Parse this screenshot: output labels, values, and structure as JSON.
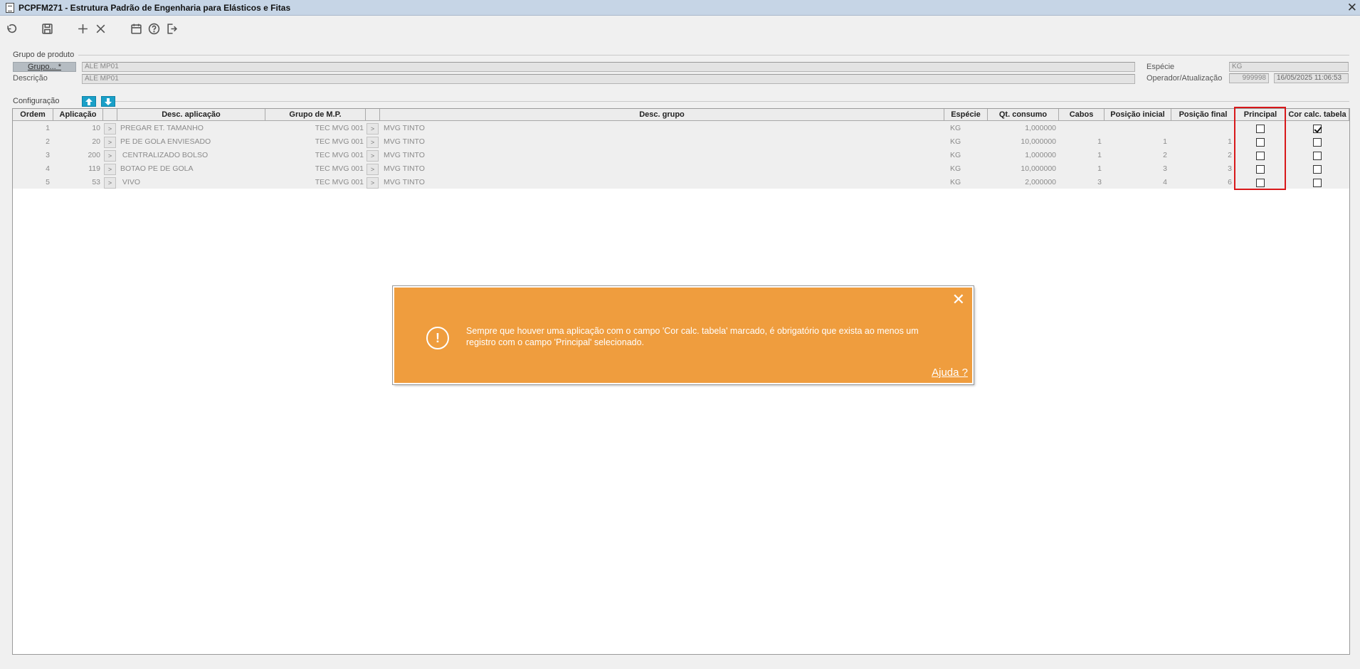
{
  "window": {
    "title": "PCPFM271 - Estrutura Padrão de Engenharia para Elásticos e Fitas",
    "close": "✕"
  },
  "toolbar": {
    "icons": [
      "undo-icon",
      "save-icon",
      "add-icon",
      "delete-icon",
      "calendar-icon",
      "help-icon",
      "exit-icon"
    ]
  },
  "grupo_produto": {
    "section_label": "Grupo de produto",
    "grupo_button": "Grupo... *",
    "grupo_value": "ALE MP01",
    "descricao_label": "Descrição",
    "descricao_value": "ALE MP01",
    "especie_label": "Espécie",
    "especie_value": "KG",
    "operador_label": "Operador/Atualização",
    "operador_value": "999998",
    "atualizacao_value": "16/05/2025 11:06:53"
  },
  "configuracao": {
    "section_label": "Configuração",
    "columns": [
      "Ordem",
      "Aplicação",
      "Desc. aplicação",
      "Grupo de M.P.",
      "Desc. grupo",
      "Espécie",
      "Qt. consumo",
      "Cabos",
      "Posição inicial",
      "Posição final",
      "Principal",
      "Cor calc. tabela"
    ],
    "rows": [
      {
        "ordem": "1",
        "aplicacao": "10",
        "desc_aplicacao": "PREGAR ET. TAMANHO",
        "grupo_mp": "TEC MVG 001",
        "desc_grupo": "MVG TINTO",
        "especie": "KG",
        "qt_consumo": "1,000000",
        "cabos": "",
        "pos_inicial": "",
        "pos_final": "",
        "principal": false,
        "cor_calc": true
      },
      {
        "ordem": "2",
        "aplicacao": "20",
        "desc_aplicacao": "PE DE GOLA ENVIESADO",
        "grupo_mp": "TEC MVG 001",
        "desc_grupo": "MVG TINTO",
        "especie": "KG",
        "qt_consumo": "10,000000",
        "cabos": "1",
        "pos_inicial": "1",
        "pos_final": "1",
        "principal": false,
        "cor_calc": false
      },
      {
        "ordem": "3",
        "aplicacao": "200",
        "desc_aplicacao": " CENTRALIZADO BOLSO",
        "grupo_mp": "TEC MVG 001",
        "desc_grupo": "MVG TINTO",
        "especie": "KG",
        "qt_consumo": "1,000000",
        "cabos": "1",
        "pos_inicial": "2",
        "pos_final": "2",
        "principal": false,
        "cor_calc": false
      },
      {
        "ordem": "4",
        "aplicacao": "119",
        "desc_aplicacao": "BOTAO PE DE GOLA",
        "grupo_mp": "TEC MVG 001",
        "desc_grupo": "MVG TINTO",
        "especie": "KG",
        "qt_consumo": "10,000000",
        "cabos": "1",
        "pos_inicial": "3",
        "pos_final": "3",
        "principal": false,
        "cor_calc": false
      },
      {
        "ordem": "5",
        "aplicacao": "53",
        "desc_aplicacao": " VIVO",
        "grupo_mp": "TEC MVG 001",
        "desc_grupo": "MVG TINTO",
        "especie": "KG",
        "qt_consumo": "2,000000",
        "cabos": "3",
        "pos_inicial": "4",
        "pos_final": "6",
        "principal": false,
        "cor_calc": false
      }
    ],
    "picker_glyph": ">"
  },
  "toast": {
    "icon_glyph": "!",
    "message": "Sempre que houver uma aplicação com o campo 'Cor calc. tabela' marcado, é obrigatório que exista ao menos um registro com o campo 'Principal' selecionado.",
    "close": "✕",
    "help_link": "Ajuda ?",
    "color": "#ef9d3e"
  },
  "colors": {
    "titlebar": "#c6d5e6",
    "highlight": "#d8181a",
    "arrow_button": "#1aa0c8"
  }
}
